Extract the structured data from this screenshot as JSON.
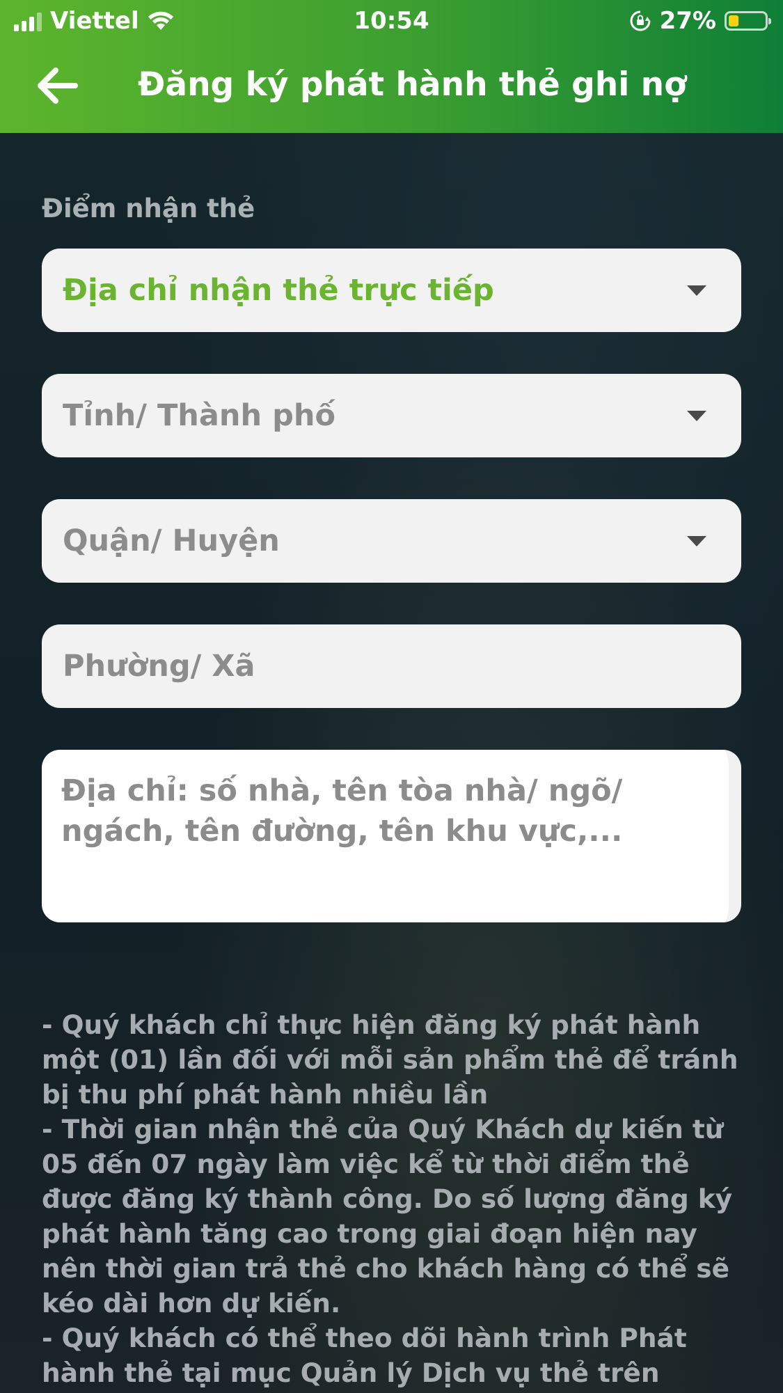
{
  "status_bar": {
    "carrier": "Viettel",
    "time": "10:54",
    "battery": "27%",
    "battery_level": 0.27
  },
  "header": {
    "title": "Đăng ký phát hành thẻ ghi nợ",
    "back_icon": "arrow-left-icon"
  },
  "form": {
    "section_label": "Điểm nhận thẻ",
    "receive_point": "Địa chỉ nhận thẻ trực tiếp",
    "province_placeholder": "Tỉnh/ Thành phố",
    "district_placeholder": "Quận/ Huyện",
    "ward_placeholder": "Phường/ Xã",
    "address_placeholder": "Địa chỉ: số nhà, tên tòa nhà/ ngõ/ ngách, tên đường, tên khu vực,..."
  },
  "notes": [
    "- Quý khách chỉ thực hiện đăng ký phát hành một (01) lần đối với mỗi sản phẩm thẻ để tránh bị thu phí phát hành nhiều lần",
    "- Thời gian nhận thẻ của Quý Khách dự kiến từ 05 đến 07 ngày làm việc kể từ thời điểm thẻ được đăng ký thành công. Do số lượng đăng ký phát hành tăng cao trong giai đoạn hiện nay nên thời gian trả thẻ cho khách hàng có thể sẽ kéo dài hơn dự kiến.",
    "- Quý khách có thể theo dõi hành trình Phát hành thẻ tại mục Quản lý Dịch vụ thẻ trên"
  ],
  "colors": {
    "header_start": "#5db52c",
    "header_end": "#0e7f36",
    "accent_green": "#6ab42f",
    "battery_yellow": "#f5d30f"
  }
}
